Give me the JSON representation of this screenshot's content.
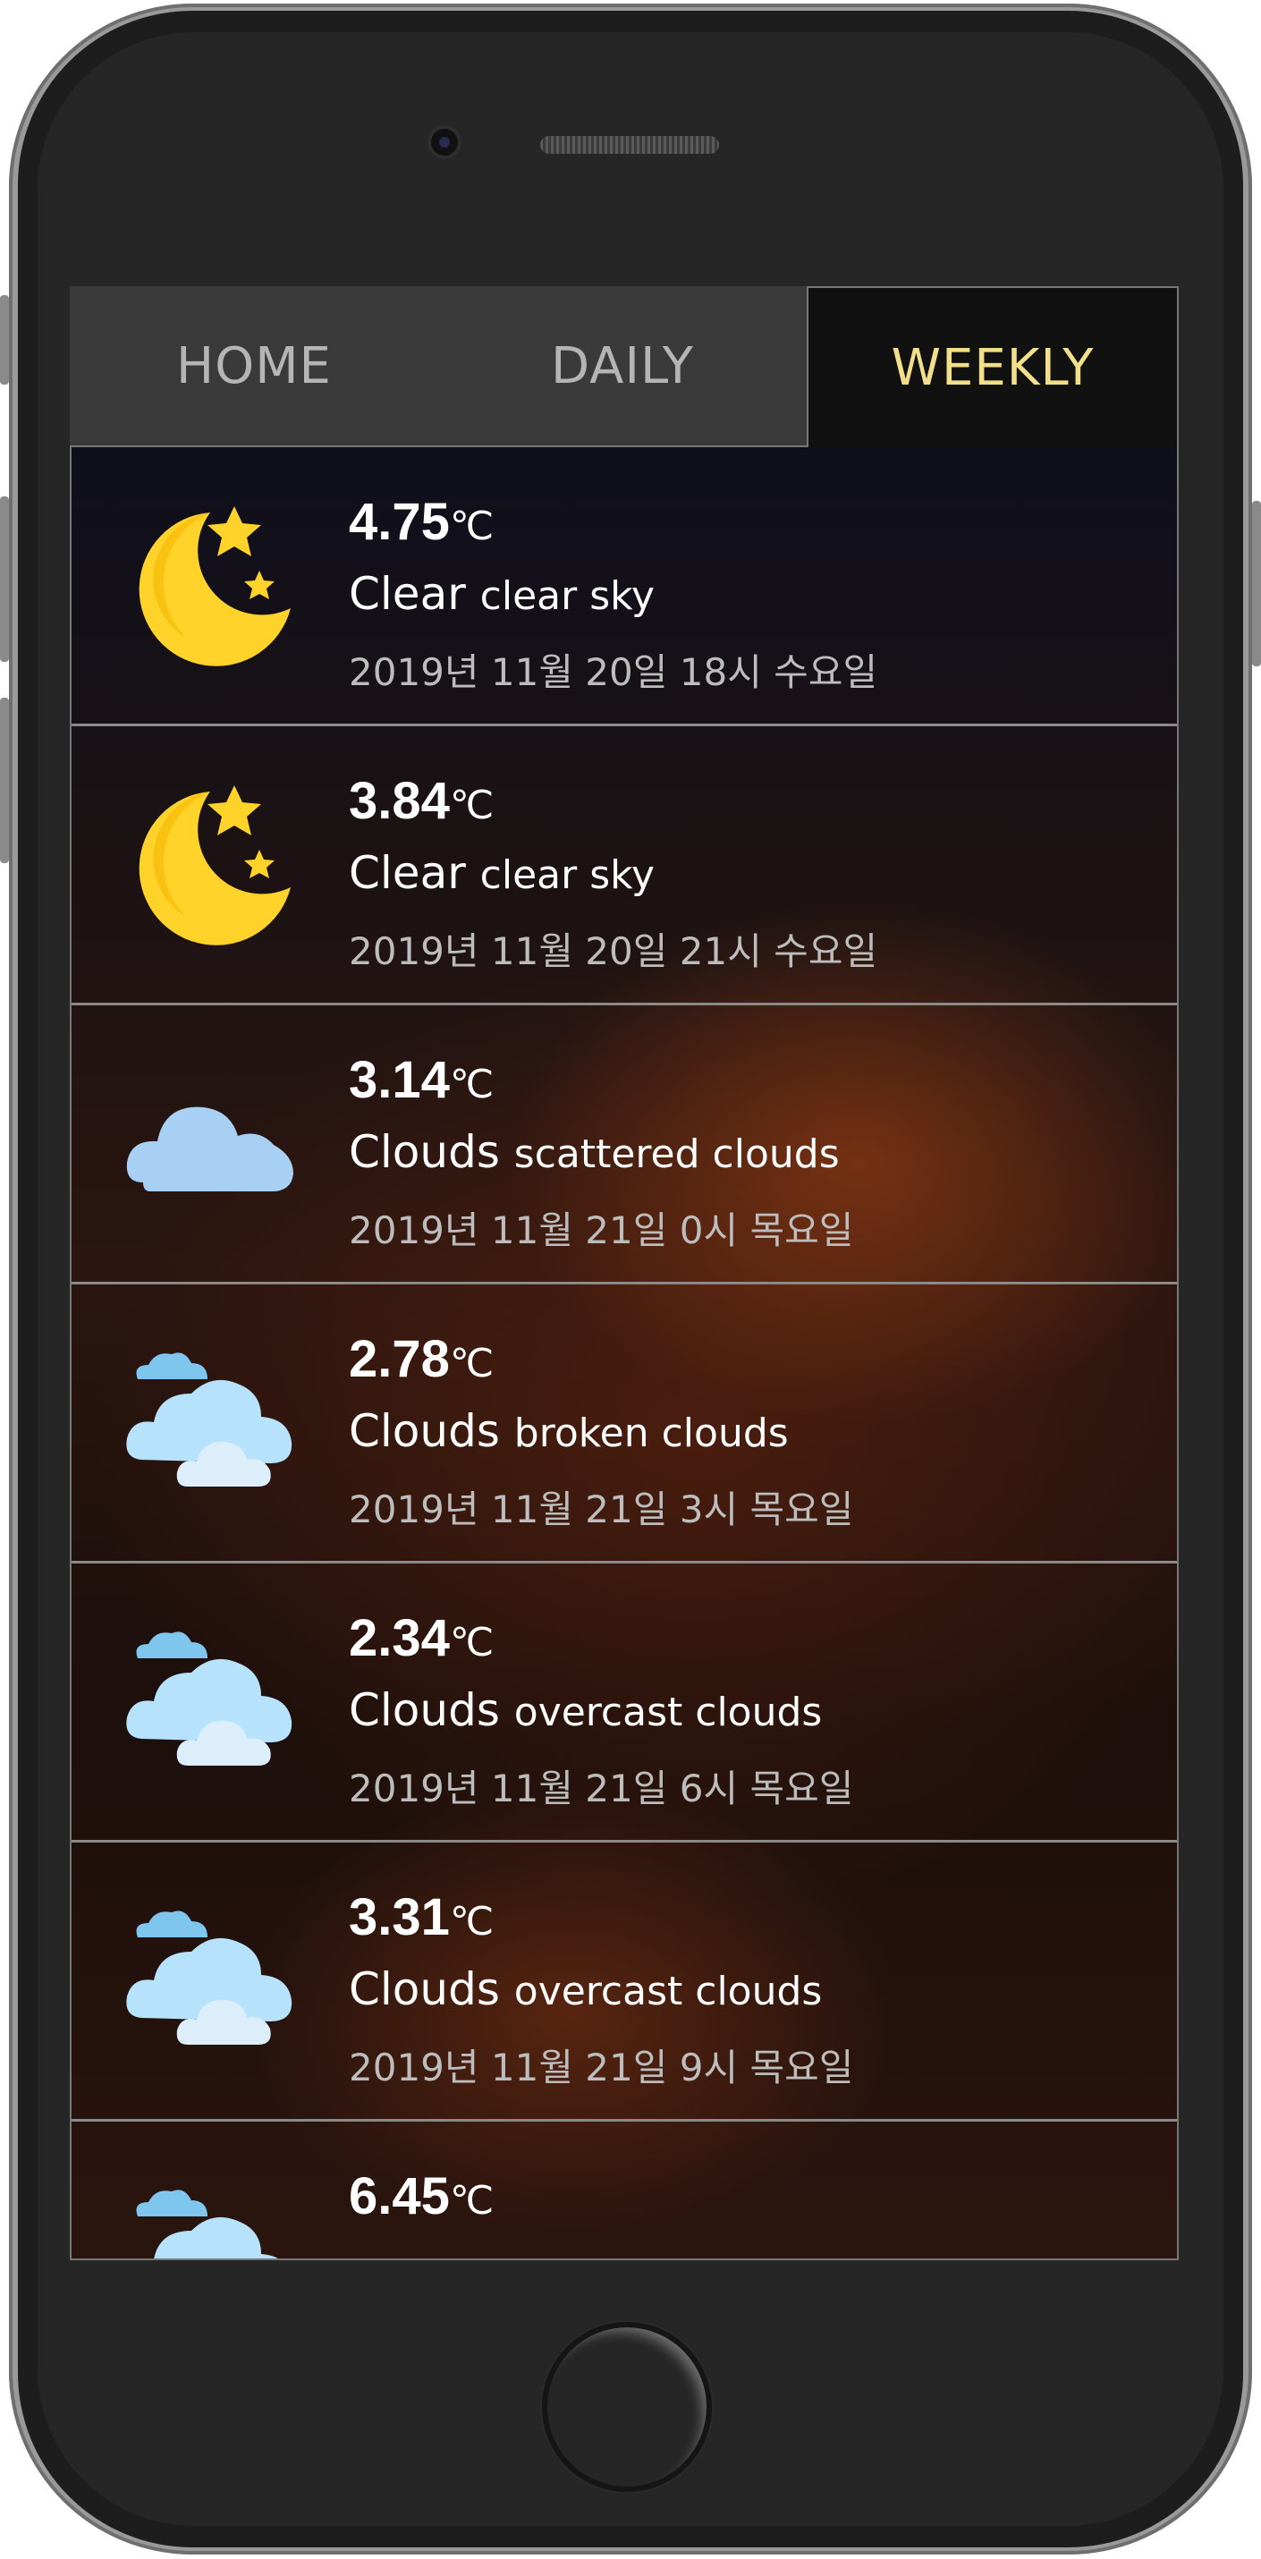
{
  "tabs": [
    {
      "label": "HOME",
      "active": false
    },
    {
      "label": "DAILY",
      "active": false
    },
    {
      "label": "WEEKLY",
      "active": true
    }
  ],
  "colors": {
    "active_tab_text": "#f2df8a",
    "tab_text": "#b5b5b5",
    "temp_text": "#ffffff",
    "date_text": "#bdbdbd"
  },
  "forecast": [
    {
      "icon": "moon-stars-icon",
      "temp": "4.75",
      "unit": "℃",
      "main": "Clear",
      "description": "clear sky",
      "datetime": "2019년 11월 20일 18시 수요일"
    },
    {
      "icon": "moon-stars-icon",
      "temp": "3.84",
      "unit": "℃",
      "main": "Clear",
      "description": "clear sky",
      "datetime": "2019년 11월 20일 21시 수요일"
    },
    {
      "icon": "cloud-icon",
      "temp": "3.14",
      "unit": "℃",
      "main": "Clouds",
      "description": "scattered clouds",
      "datetime": "2019년 11월 21일 0시 목요일"
    },
    {
      "icon": "clouds-icon",
      "temp": "2.78",
      "unit": "℃",
      "main": "Clouds",
      "description": "broken clouds",
      "datetime": "2019년 11월 21일 3시 목요일"
    },
    {
      "icon": "clouds-icon",
      "temp": "2.34",
      "unit": "℃",
      "main": "Clouds",
      "description": "overcast clouds",
      "datetime": "2019년 11월 21일 6시 목요일"
    },
    {
      "icon": "clouds-icon",
      "temp": "3.31",
      "unit": "℃",
      "main": "Clouds",
      "description": "overcast clouds",
      "datetime": "2019년 11월 21일 9시 목요일"
    },
    {
      "icon": "clouds-icon",
      "temp": "6.45",
      "unit": "℃",
      "main": "",
      "description": "",
      "datetime": ""
    }
  ]
}
